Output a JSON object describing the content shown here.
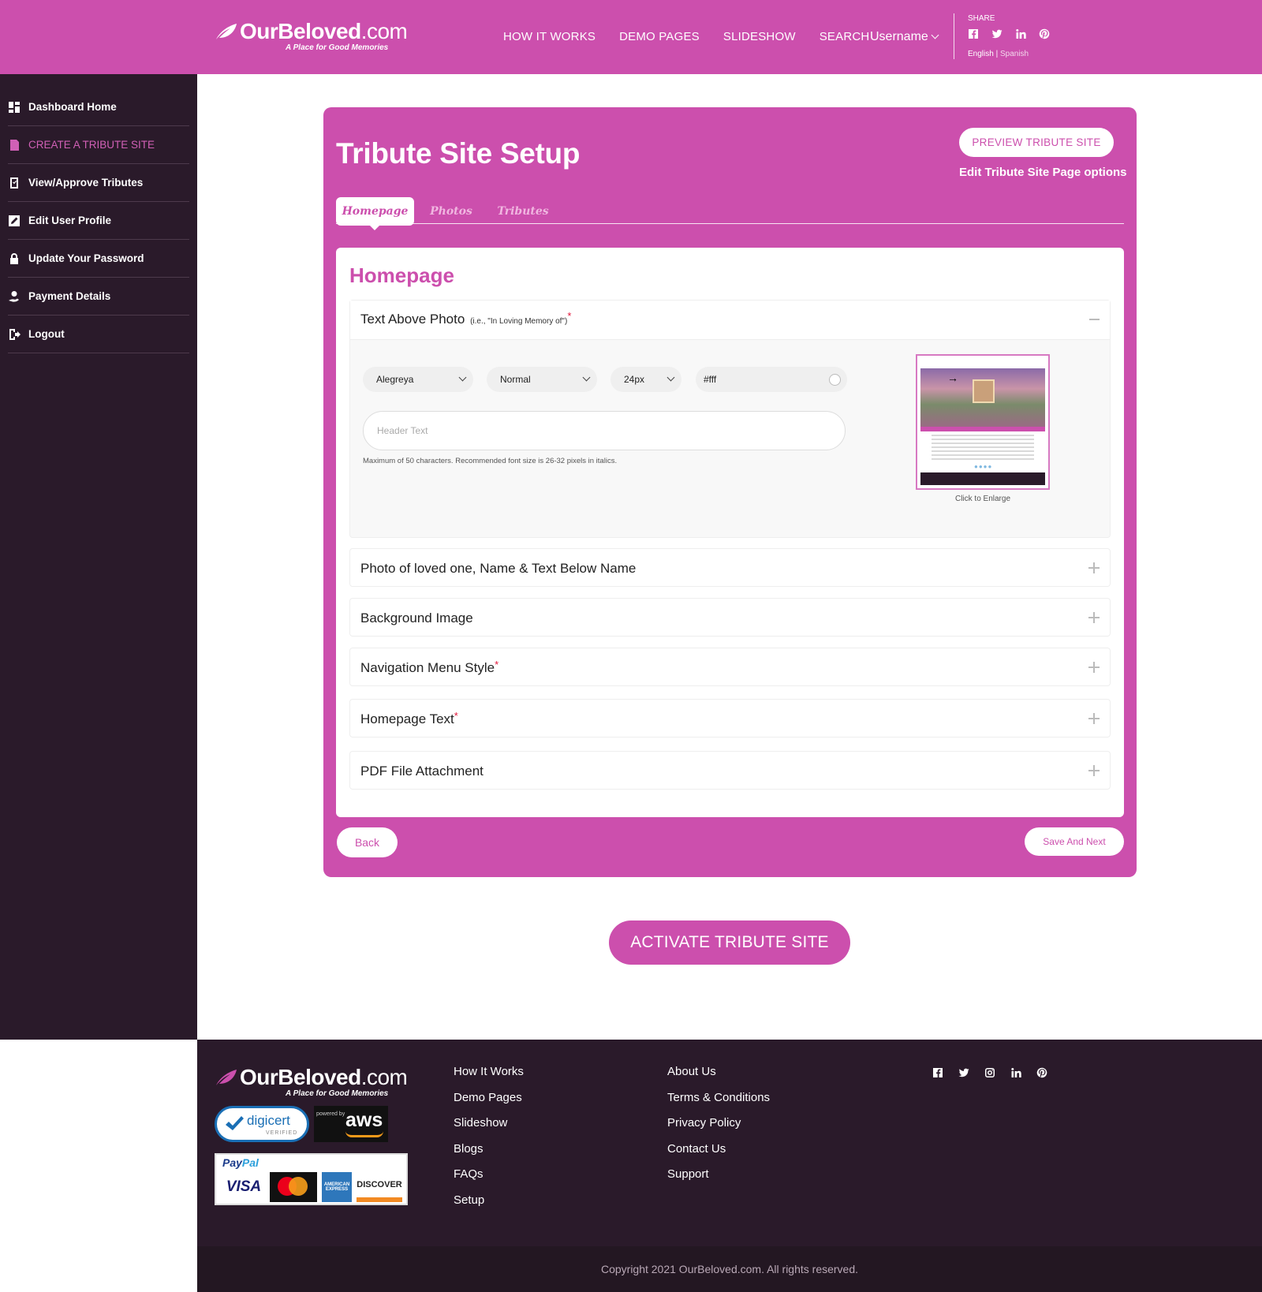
{
  "brand": {
    "name_bold": "OurBeloved",
    "name_tld": ".com",
    "tagline": "A Place for Good Memories"
  },
  "header": {
    "nav": [
      {
        "label": "HOW IT WORKS"
      },
      {
        "label": "DEMO PAGES"
      },
      {
        "label": "SLIDESHOW"
      },
      {
        "label": "SEARCH"
      }
    ],
    "username": "Username",
    "share_label": "SHARE",
    "share_icons": [
      "facebook-icon",
      "twitter-icon",
      "linkedin-icon",
      "pinterest-icon"
    ],
    "lang_english": "English",
    "lang_sep": " | ",
    "lang_spanish": "Spanish"
  },
  "sidebar": {
    "items": [
      {
        "label": "Dashboard Home",
        "icon": "dashboard-icon",
        "active": false
      },
      {
        "label": "CREATE A TRIBUTE SITE",
        "icon": "document-icon",
        "active": true
      },
      {
        "label": "View/Approve Tributes",
        "icon": "approve-icon",
        "active": false
      },
      {
        "label": "Edit User Profile",
        "icon": "edit-icon",
        "active": false
      },
      {
        "label": "Update Your Password",
        "icon": "lock-icon",
        "active": false
      },
      {
        "label": "Payment Details",
        "icon": "payment-icon",
        "active": false
      },
      {
        "label": "Logout",
        "icon": "logout-icon",
        "active": false
      }
    ]
  },
  "setup": {
    "title": "Tribute Site Setup",
    "preview_button": "PREVIEW TRIBUTE SITE",
    "edit_options": "Edit Tribute Site Page options",
    "tabs": [
      {
        "label": "Homepage",
        "active": true
      },
      {
        "label": "Photos",
        "active": false
      },
      {
        "label": "Tributes",
        "active": false
      }
    ],
    "panel_title": "Homepage",
    "open_section": {
      "label": "Text Above Photo",
      "hint_small": "(i.e., \"In Loving Memory of\")",
      "required_mark": "*",
      "font_family": "Alegreya",
      "font_style": "Normal",
      "font_size": "24px",
      "color_value": "#fff",
      "header_text_placeholder": "Header Text",
      "header_text_value": "",
      "helper_text": "Maximum of 50 characters. Recommended font size is 26-32 pixels in italics.",
      "thumbnail_caption": "Click to Enlarge"
    },
    "sections": [
      {
        "label": "Photo of loved one, Name & Text Below Name",
        "required": ""
      },
      {
        "label": "Background Image",
        "required": ""
      },
      {
        "label": "Navigation Menu Style",
        "required": "*"
      },
      {
        "label": "Homepage Text",
        "required": "*"
      },
      {
        "label": "PDF File Attachment",
        "required": ""
      }
    ],
    "back_button": "Back",
    "save_button": "Save And Next",
    "activate_button": "ACTIVATE TRIBUTE SITE"
  },
  "footer": {
    "col1": [
      "How It Works",
      "Demo Pages",
      "Slideshow",
      "Blogs",
      "FAQs",
      "Setup"
    ],
    "col2": [
      "About Us",
      "Terms & Conditions",
      "Privacy Policy",
      "Contact Us",
      "Support"
    ],
    "social_icons": [
      "facebook-icon",
      "twitter-icon",
      "instagram-icon",
      "linkedin-icon",
      "pinterest-icon"
    ],
    "badges": {
      "digicert": "digicert",
      "digicert_sub": "VERIFIED",
      "aws_powered": "powered by",
      "aws": "aws",
      "paypal_a": "Pay",
      "paypal_b": "Pal",
      "visa": "VISA",
      "amex": "AMERICAN EXPRESS",
      "discover": "DISCOVER"
    },
    "copyright": "Copyright 2021 OurBeloved.com. All rights reserved."
  },
  "colors": {
    "brand_pink": "#cc4fad",
    "sidebar_dark": "#2a1a2a",
    "required_red": "#e2173a"
  }
}
